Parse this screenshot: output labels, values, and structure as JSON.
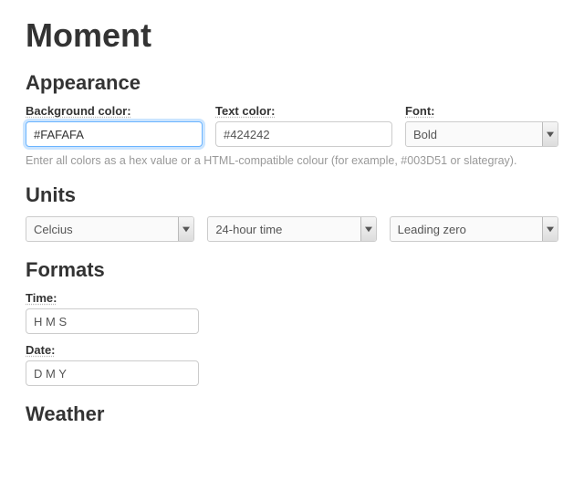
{
  "title": "Moment",
  "sections": {
    "appearance": {
      "heading": "Appearance",
      "background_label": "Background color:",
      "background_value": "#FAFAFA",
      "text_label": "Text color:",
      "text_value": "#424242",
      "font_label": "Font:",
      "font_value": "Bold",
      "help": "Enter all colors as a hex value or a HTML-compatible colour (for example, #003D51 or slategray)."
    },
    "units": {
      "heading": "Units",
      "temperature_value": "Celcius",
      "time_value": "24-hour time",
      "leading_value": "Leading zero"
    },
    "formats": {
      "heading": "Formats",
      "time_label": "Time:",
      "time_value": "H M S",
      "date_label": "Date:",
      "date_value": "D M Y"
    },
    "weather": {
      "heading": "Weather"
    }
  }
}
